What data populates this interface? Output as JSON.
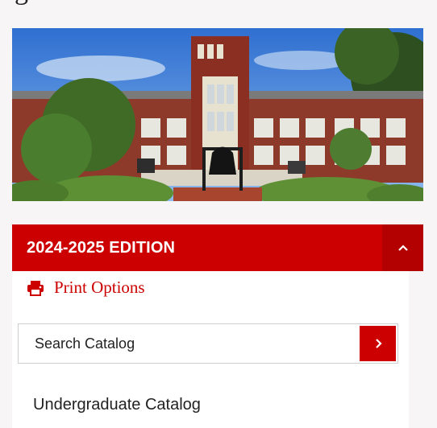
{
  "page": {
    "heading_fragment": "g"
  },
  "sidebar": {
    "edition_label": "2024-2025 EDITION",
    "print_options_label": "Print Options",
    "search": {
      "placeholder": "Search Catalog"
    },
    "nav_items": [
      "Undergraduate Catalog"
    ]
  },
  "colors": {
    "accent": "#cc0000",
    "accent_dark": "#b30000",
    "background": "#f7f5f5"
  },
  "icons": {
    "print": "print-icon",
    "toggle": "chevron-up-icon",
    "search_submit": "chevron-right-icon"
  }
}
